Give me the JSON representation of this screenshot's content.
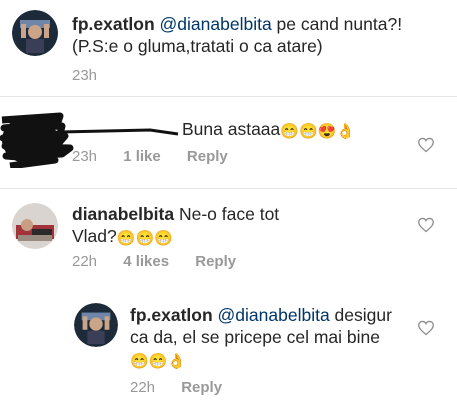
{
  "comments": [
    {
      "username": "fp.exatlon",
      "mention": "@dianabelbita",
      "text": " pe cand nunta?!   (P.S:e o gluma,tratati o ca atare)",
      "time": "23h",
      "likes": "",
      "reply": ""
    },
    {
      "username": "",
      "text": "Buna astaaa",
      "emojis": "😁😁😍👌",
      "time": "23h",
      "likes": "1 like",
      "reply": "Reply"
    },
    {
      "username": "dianabelbita",
      "text": " Ne-o face tot Vlad?",
      "emojis": "😁😁😁",
      "time": "22h",
      "likes": "4 likes",
      "reply": "Reply"
    },
    {
      "username": "fp.exatlon",
      "mention": "@dianabelbita",
      "text": " desigur ca da, el se pricepe cel mai bine",
      "emojis": "😁😁👌",
      "time": "22h",
      "likes": "",
      "reply": "Reply"
    }
  ],
  "icons": {
    "like": "heart-outline-icon",
    "avatar": "profile-avatar"
  },
  "colors": {
    "meta": "#999999",
    "mention": "#003569",
    "text": "#262626"
  }
}
